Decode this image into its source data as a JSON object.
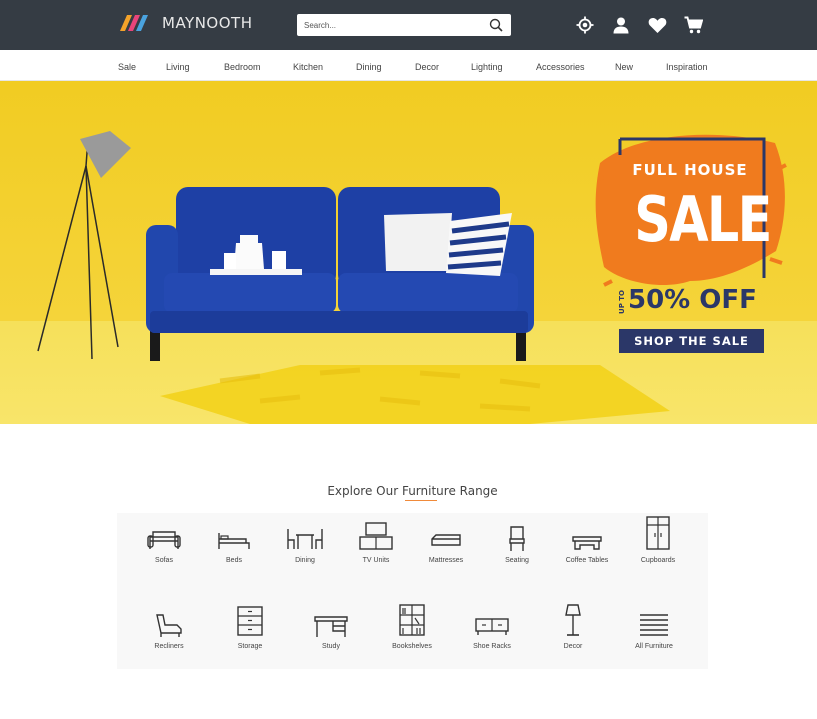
{
  "header": {
    "logo_text": "MAYNOOTH",
    "search_placeholder": "Search...",
    "icons": [
      "location-icon",
      "user-icon",
      "heart-icon",
      "cart-icon"
    ]
  },
  "nav": {
    "items": [
      "Sale",
      "Living",
      "Bedroom",
      "Kitchen",
      "Dining",
      "Decor",
      "Lighting",
      "Accessories",
      "New",
      "Inspiration"
    ]
  },
  "hero": {
    "line1": "FULL HOUSE",
    "line2": "SALE",
    "upto": "UP TO",
    "discount": "50% OFF",
    "cta": "SHOP THE SALE",
    "colors": {
      "background": "#f2cf2a",
      "accent": "#f07b1e",
      "navy": "#2b3768",
      "sofa": "#1f43a8"
    }
  },
  "explore": {
    "title": "Explore Our Furniture Range",
    "categories_row1": [
      {
        "label": "Sofas",
        "icon": "sofa-icon"
      },
      {
        "label": "Beds",
        "icon": "bed-icon"
      },
      {
        "label": "Dining",
        "icon": "dining-icon"
      },
      {
        "label": "TV Units",
        "icon": "tv-unit-icon"
      },
      {
        "label": "Mattresses",
        "icon": "mattress-icon"
      },
      {
        "label": "Seating",
        "icon": "chair-icon"
      },
      {
        "label": "Coffee Tables",
        "icon": "coffee-table-icon"
      },
      {
        "label": "Cupboards",
        "icon": "cupboard-icon"
      }
    ],
    "categories_row2": [
      {
        "label": "Recliners",
        "icon": "recliner-icon"
      },
      {
        "label": "Storage",
        "icon": "storage-icon"
      },
      {
        "label": "Study",
        "icon": "desk-icon"
      },
      {
        "label": "Bookshelves",
        "icon": "bookshelf-icon"
      },
      {
        "label": "Shoe Racks",
        "icon": "shoe-rack-icon"
      },
      {
        "label": "Decor",
        "icon": "lamp-icon"
      },
      {
        "label": "All Furniture",
        "icon": "list-icon"
      }
    ]
  }
}
